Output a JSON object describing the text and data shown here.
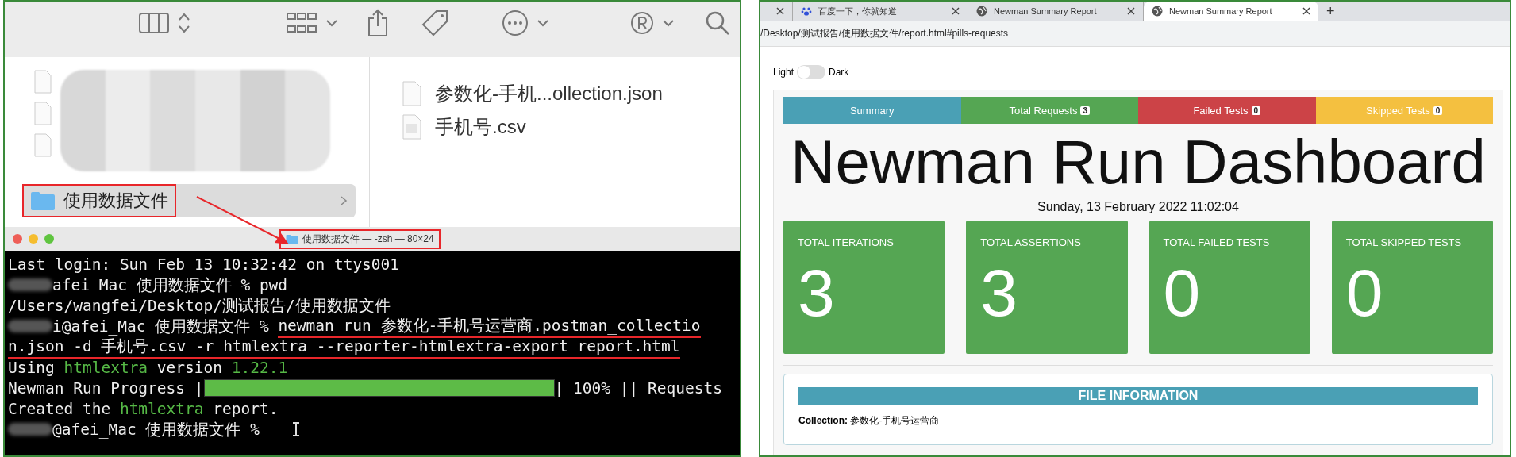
{
  "finder": {
    "folder": {
      "name": "使用数据文件",
      "selected": true
    },
    "files": [
      {
        "name": "参数化-手机...ollection.json",
        "kind": "blank"
      },
      {
        "name": "手机号.csv",
        "kind": "csv"
      }
    ]
  },
  "terminal": {
    "title": "使用数据文件 — -zsh — 80×24",
    "lines": [
      {
        "kind": "text",
        "redacted": false,
        "segments": [
          {
            "text": "Last login: Sun Feb 13 10:32:42 on ttys001",
            "kind": "plain"
          }
        ]
      },
      {
        "kind": "text",
        "redacted": true,
        "segments": [
          {
            "text": "afei_Mac 使用数据文件 % pwd",
            "kind": "plain"
          }
        ]
      },
      {
        "kind": "text",
        "redacted": false,
        "segments": [
          {
            "text": "/Users/wangfei/Desktop/测试报告/使用数据文件",
            "kind": "plain"
          }
        ]
      },
      {
        "kind": "text",
        "redacted": true,
        "segments": [
          {
            "text": "i@afei_Mac 使用数据文件 % ",
            "kind": "plain"
          },
          {
            "text": "newman run 参数化-手机号运营商.postman_collectio",
            "kind": "command"
          }
        ]
      },
      {
        "kind": "text",
        "redacted": false,
        "segments": [
          {
            "text": "n.json -d 手机号.csv -r htmlextra --reporter-htmlextra-export report.html",
            "kind": "command"
          }
        ]
      },
      {
        "kind": "text",
        "redacted": false,
        "segments": [
          {
            "text": "Using ",
            "kind": "plain"
          },
          {
            "text": "htmlextra",
            "kind": "green"
          },
          {
            "text": " version ",
            "kind": "plain"
          },
          {
            "text": "1.22.1",
            "kind": "green"
          }
        ]
      },
      {
        "kind": "progress",
        "label": "Newman Run Progress |",
        "level": 1,
        "suffix": "| 100% || Requests"
      },
      {
        "kind": "text",
        "redacted": false,
        "segments": [
          {
            "text": "Created the ",
            "kind": "plain"
          },
          {
            "text": "htmlextra",
            "kind": "green"
          },
          {
            "text": " report.",
            "kind": "plain"
          }
        ]
      },
      {
        "kind": "text",
        "redacted": true,
        "segments": [
          {
            "text": "@afei_Mac 使用数据文件 %",
            "kind": "plain"
          }
        ]
      }
    ]
  },
  "browser": {
    "tabs": [
      {
        "selected": false,
        "kind": "cut"
      },
      {
        "label": "百度一下，你就知道",
        "selected": false,
        "kind": "paw"
      },
      {
        "label": "Newman Summary Report",
        "selected": false,
        "kind": "globe"
      },
      {
        "label": "Newman Summary Report",
        "selected": true,
        "kind": "globe"
      }
    ],
    "new_tab": "+",
    "url": "/Desktop/测试报告/使用数据文件/report.html#pills-requests"
  },
  "report": {
    "theme_toggle": {
      "light_label": "Light",
      "dark_label": "Dark",
      "on": false
    },
    "pills": [
      {
        "label": "Summary",
        "color": "#4aa0b5"
      },
      {
        "label": "Total Requests",
        "count": "3",
        "color": "#55a653"
      },
      {
        "label": "Failed Tests",
        "count": "0",
        "color": "#cc4347"
      },
      {
        "label": "Skipped Tests",
        "count": "0",
        "color": "#f4c040"
      }
    ],
    "title": "Newman Run Dashboard",
    "date": "Sunday, 13 February 2022 11:02:04",
    "cards": [
      {
        "label": "TOTAL ITERATIONS",
        "value": "3"
      },
      {
        "label": "TOTAL ASSERTIONS",
        "value": "3"
      },
      {
        "label": "TOTAL FAILED TESTS",
        "value": "0"
      },
      {
        "label": "TOTAL SKIPPED TESTS",
        "value": "0"
      }
    ],
    "file_info": {
      "heading": "FILE INFORMATION",
      "collection_label": "Collection:",
      "collection_value": "参数化-手机号运营商"
    }
  }
}
